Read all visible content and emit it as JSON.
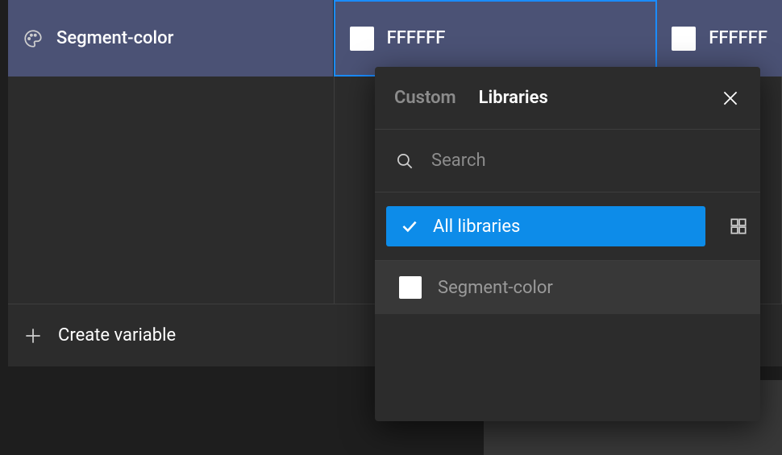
{
  "row": {
    "variable_name": "Segment-color",
    "value1": "FFFFFF",
    "value2": "FFFFFF",
    "swatch_color": "#FFFFFF"
  },
  "footer": {
    "create_label": "Create variable"
  },
  "popover": {
    "tabs": {
      "custom": "Custom",
      "libraries": "Libraries"
    },
    "search_placeholder": "Search",
    "scope_label": "All libraries",
    "items": [
      {
        "label": "Segment-color",
        "swatch": "#FFFFFF"
      }
    ]
  },
  "colors": {
    "row_bg": "#4b5275",
    "panel_bg": "#2c2c2c",
    "accent": "#0d8ce9",
    "selection_border": "#1a8cff"
  }
}
